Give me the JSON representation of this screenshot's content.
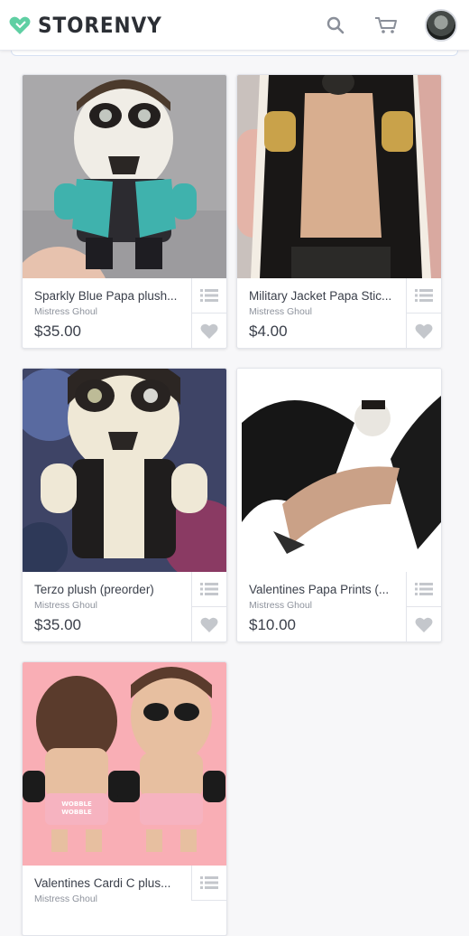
{
  "brand": {
    "name": "STORENVY",
    "accent": "#5fcfa3"
  },
  "header": {
    "icons": [
      "search-icon",
      "cart-icon",
      "avatar"
    ]
  },
  "products": [
    {
      "title": "Sparkly Blue Papa plush...",
      "seller": "Mistress Ghoul",
      "price": "$35.00"
    },
    {
      "title": "Military Jacket Papa Stic...",
      "seller": "Mistress Ghoul",
      "price": "$4.00"
    },
    {
      "title": "Terzo plush (preorder)",
      "seller": "Mistress Ghoul",
      "price": "$35.00"
    },
    {
      "title": "Valentines Papa Prints (...",
      "seller": "Mistress Ghoul",
      "price": "$10.00"
    },
    {
      "title": "Valentines Cardi C plus...",
      "seller": "Mistress Ghoul",
      "price": ""
    }
  ],
  "card_icons": {
    "list": "list-icon",
    "heart": "heart-icon"
  },
  "art": {
    "wobble_text": "WOBBLE WOBBLE"
  }
}
